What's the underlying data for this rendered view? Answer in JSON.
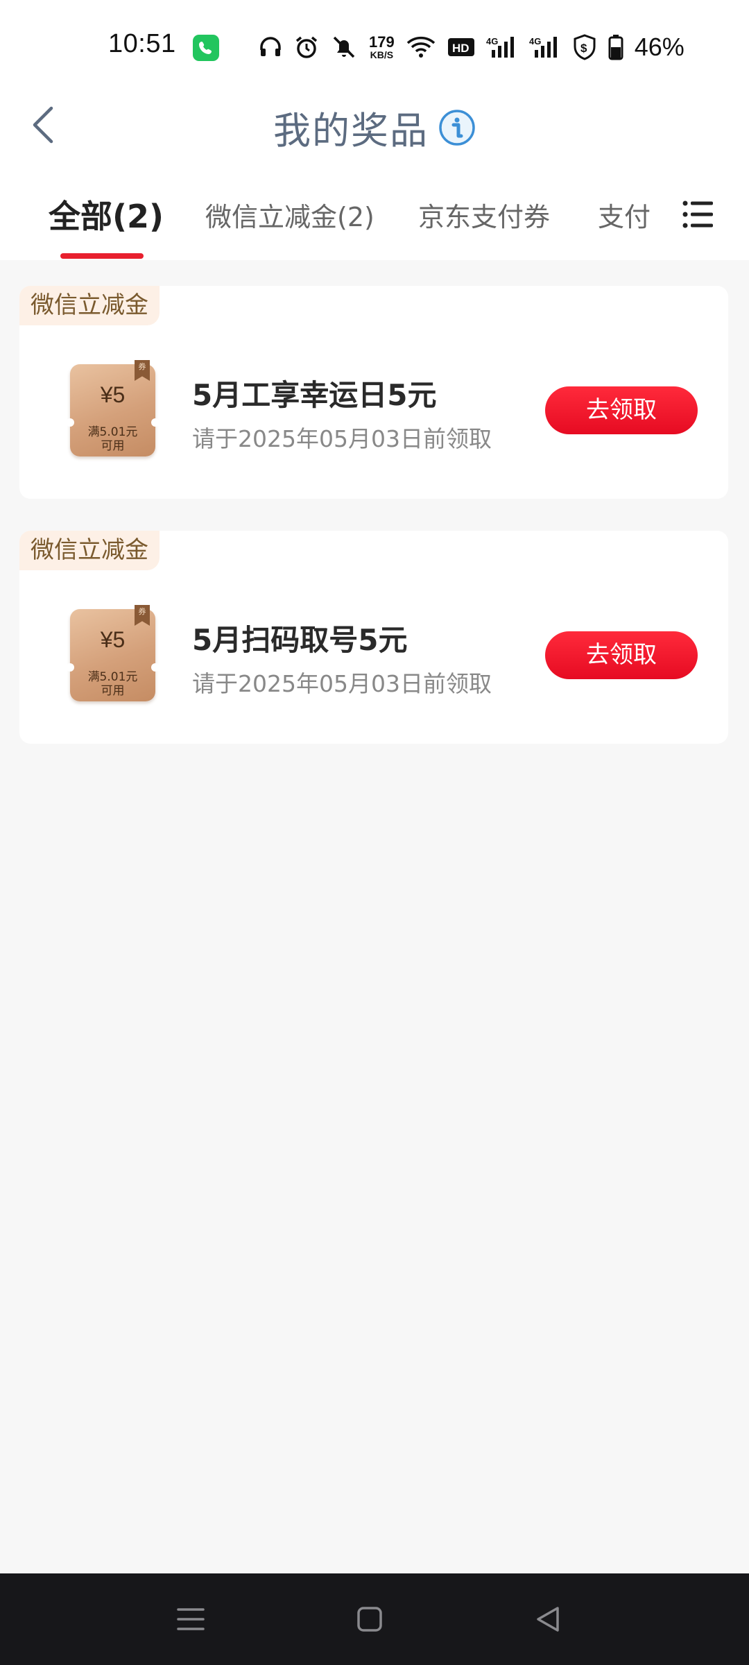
{
  "status_bar": {
    "time": "10:51",
    "net_speed": "179",
    "net_speed_unit": "KB/S",
    "battery_percent": "46%",
    "icons": [
      "phone-call-icon",
      "headphones-icon",
      "alarm-icon",
      "mute-icon",
      "wifi-icon",
      "hd-icon",
      "signal-4g-icon",
      "signal-4g-icon",
      "shield-dollar-icon",
      "battery-icon"
    ]
  },
  "header": {
    "title": "我的奖品",
    "back_icon": "chevron-left-icon",
    "info_icon": "info-icon"
  },
  "tabs": [
    {
      "label": "全部(2)",
      "active": true
    },
    {
      "label": "微信立减金(2)",
      "active": false
    },
    {
      "label": "京东支付券",
      "active": false
    },
    {
      "label": "支付",
      "active": false
    }
  ],
  "tab_menu_icon": "list-menu-icon",
  "prizes": [
    {
      "category": "微信立减金",
      "coupon_amount": "¥5",
      "coupon_ribbon": "券",
      "coupon_condition_1": "满5.01元",
      "coupon_condition_2": "可用",
      "name": "5月工享幸运日5元",
      "deadline": "请于2025年05月03日前领取",
      "action": "去领取"
    },
    {
      "category": "微信立减金",
      "coupon_amount": "¥5",
      "coupon_ribbon": "券",
      "coupon_condition_1": "满5.01元",
      "coupon_condition_2": "可用",
      "name": "5月扫码取号5元",
      "deadline": "请于2025年05月03日前领取",
      "action": "去领取"
    }
  ],
  "nav_bar": {
    "icons": [
      "recent-apps-icon",
      "home-icon",
      "back-triangle-icon"
    ]
  },
  "colors": {
    "accent_red": "#e8202e",
    "title_gray_blue": "#5c6b80",
    "badge_bg": "#fdf0e6",
    "badge_text": "#7a5a2e",
    "coupon_bronze": "#d4a07a"
  }
}
